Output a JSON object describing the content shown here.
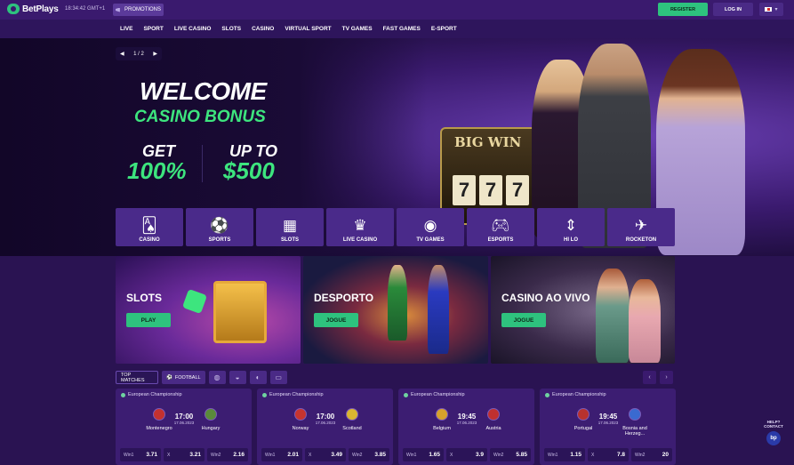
{
  "brand": {
    "name": "BetPlays"
  },
  "header": {
    "time": "18:34:42",
    "timezone": "GMT+1",
    "promotions_label": "PROMOTIONS",
    "register_label": "REGISTER",
    "login_label": "LOG IN"
  },
  "nav": [
    "LIVE",
    "SPORT",
    "LIVE CASINO",
    "SLOTS",
    "CASINO",
    "VIRTUAL SPORT",
    "TV GAMES",
    "FAST GAMES",
    "E-SPORT"
  ],
  "hero": {
    "pager": "1 / 2",
    "title": "WELCOME",
    "subtitle": "CASINO BONUS",
    "get": "GET",
    "percent": "100%",
    "up_to": "UP TO",
    "amount": "$500",
    "slot_sign": "BIG WIN",
    "reels": [
      "7",
      "7",
      "7"
    ]
  },
  "categories": [
    {
      "label": "CASINO",
      "icon": "cards-icon"
    },
    {
      "label": "SPORTS",
      "icon": "football-icon"
    },
    {
      "label": "SLOTS",
      "icon": "slot-machine-icon"
    },
    {
      "label": "LIVE CASINO",
      "icon": "dealer-icon"
    },
    {
      "label": "TV GAMES",
      "icon": "tv-ball-icon"
    },
    {
      "label": "ESPORTS",
      "icon": "gamepad-icon"
    },
    {
      "label": "HI LO",
      "icon": "up-down-icon"
    },
    {
      "label": "ROCKETON",
      "icon": "rocket-icon"
    }
  ],
  "banners": [
    {
      "title": "SLOTS",
      "button": "PLAY"
    },
    {
      "title": "DESPORTO",
      "button": "JOGUE"
    },
    {
      "title": "CASINO AO VIVO",
      "button": "JOGUE"
    }
  ],
  "match_tabs": {
    "top": "TOP MATCHES",
    "football": "FOOTBALL"
  },
  "matches": [
    {
      "league": "European Championship",
      "home": "Montenegro",
      "away": "Hungary",
      "time": "17:00",
      "date": "17.06.2023",
      "odds": {
        "w1_label": "Win1",
        "w1": "3.71",
        "x_label": "X",
        "x": "3.21",
        "w2_label": "Win2",
        "w2": "2.16"
      },
      "home_color": "#c4312f",
      "away_color": "#5a8a3a"
    },
    {
      "league": "European Championship",
      "home": "Norway",
      "away": "Scotland",
      "time": "17:00",
      "date": "17.06.2023",
      "odds": {
        "w1_label": "Win1",
        "w1": "2.01",
        "x_label": "X",
        "x": "3.49",
        "w2_label": "Win2",
        "w2": "3.85"
      },
      "home_color": "#c8342f",
      "away_color": "#d9b630"
    },
    {
      "league": "European Championship",
      "home": "Belgium",
      "away": "Austria",
      "time": "19:45",
      "date": "17.06.2023",
      "odds": {
        "w1_label": "Win1",
        "w1": "1.65",
        "x_label": "X",
        "x": "3.9",
        "w2_label": "Win2",
        "w2": "5.85"
      },
      "home_color": "#d6a22c",
      "away_color": "#c03030"
    },
    {
      "league": "European Championship",
      "home": "Portugal",
      "away": "Bosnia and Herzeg...",
      "time": "19:45",
      "date": "17.06.2023",
      "odds": {
        "w1_label": "Win1",
        "w1": "1.15",
        "x_label": "X",
        "x": "7.8",
        "w2_label": "Win2",
        "w2": "20"
      },
      "home_color": "#b8322e",
      "away_color": "#3a6ad0"
    }
  ],
  "help": {
    "label": "HELP? CONTACT",
    "button": "bp"
  },
  "colors": {
    "accent": "#2ec27e",
    "background": "#2a1352",
    "header": "#3a1a6e",
    "tile": "#4a2a8a"
  }
}
